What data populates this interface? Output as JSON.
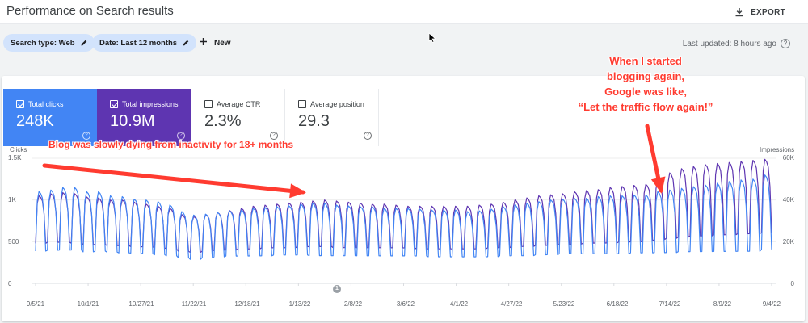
{
  "header": {
    "title": "Performance on Search results",
    "export_label": "EXPORT"
  },
  "filters": {
    "search_type": "Search type: Web",
    "date": "Date: Last 12 months",
    "new_label": "New",
    "last_updated": "Last updated: 8 hours ago"
  },
  "metrics": {
    "clicks": {
      "label": "Total clicks",
      "value": "248K",
      "selected": true
    },
    "impressions": {
      "label": "Total impressions",
      "value": "10.9M",
      "selected": true
    },
    "ctr": {
      "label": "Average CTR",
      "value": "2.3%",
      "selected": false
    },
    "position": {
      "label": "Average position",
      "value": "29.3",
      "selected": false
    }
  },
  "colors": {
    "clicks": "#4285f4",
    "impressions": "#5e35b1",
    "annotation": "#ff3b30"
  },
  "chart_data": {
    "type": "line",
    "left_axis": {
      "label": "Clicks",
      "ticks": [
        "1.5K",
        "1K",
        "500",
        "0"
      ],
      "range": [
        0,
        1500
      ]
    },
    "right_axis": {
      "label": "Impressions",
      "ticks": [
        "60K",
        "40K",
        "20K",
        "0"
      ],
      "range": [
        0,
        60000
      ]
    },
    "x_ticks": [
      "9/5/21",
      "10/1/21",
      "10/27/21",
      "11/22/21",
      "12/18/21",
      "1/13/22",
      "2/8/22",
      "3/6/22",
      "4/1/22",
      "4/27/22",
      "5/23/22",
      "6/18/22",
      "7/14/22",
      "8/9/22",
      "9/4/22"
    ],
    "grid": true,
    "marker_label": "1",
    "series": [
      {
        "name": "Total clicks",
        "axis": "left",
        "weekly_peak": [
          1100,
          1120,
          1150,
          1150,
          1100,
          1100,
          1050,
          1040,
          1010,
          1000,
          980,
          940,
          860,
          820,
          830,
          850,
          870,
          880,
          900,
          910,
          920,
          930,
          950,
          960,
          960,
          940,
          930,
          920,
          920,
          900,
          900,
          900,
          890,
          880,
          880,
          880,
          860,
          870,
          890,
          920,
          940,
          960,
          980,
          1000,
          1010,
          1020,
          1020,
          1040,
          1050,
          1050,
          1060,
          1060,
          1100,
          1120,
          1140,
          1160,
          1180,
          1200,
          1220,
          1240,
          1250,
          1300
        ],
        "weekly_trough": [
          350,
          360,
          360,
          360,
          340,
          350,
          340,
          330,
          330,
          320,
          310,
          300,
          280,
          260,
          280,
          290,
          300,
          300,
          300,
          300,
          310,
          310,
          310,
          300,
          300,
          300,
          300,
          300,
          300,
          300,
          300,
          300,
          300,
          290,
          290,
          290,
          290,
          290,
          290,
          300,
          300,
          300,
          310,
          310,
          320,
          320,
          320,
          320,
          320,
          320,
          330,
          330,
          330,
          330,
          340,
          340,
          340,
          340,
          340,
          340,
          340,
          360
        ]
      },
      {
        "name": "Total impressions",
        "axis": "right",
        "weekly_peak": [
          42000,
          43000,
          43500,
          43000,
          41500,
          41000,
          40000,
          40000,
          39000,
          38000,
          37000,
          36000,
          33000,
          32000,
          33000,
          34000,
          35000,
          36000,
          37000,
          37500,
          38000,
          38500,
          39000,
          39500,
          40000,
          39500,
          39000,
          38500,
          38000,
          38000,
          37500,
          37000,
          37000,
          37000,
          37000,
          37000,
          37000,
          37500,
          38000,
          39000,
          40000,
          41000,
          42000,
          42500,
          43000,
          44000,
          44500,
          45000,
          46000,
          46500,
          47000,
          47500,
          50000,
          53000,
          55000,
          56000,
          57000,
          57500,
          58000,
          58500,
          59000,
          59500
        ],
        "weekly_trough": [
          18000,
          18500,
          18500,
          18000,
          17500,
          17500,
          17000,
          17000,
          16500,
          16500,
          16000,
          15500,
          14500,
          14000,
          14500,
          15000,
          15000,
          15500,
          15500,
          16000,
          16000,
          16000,
          16500,
          16500,
          16500,
          16000,
          16000,
          16000,
          16000,
          16000,
          16000,
          16000,
          15500,
          15500,
          15500,
          15500,
          15500,
          15500,
          16000,
          16000,
          16500,
          16500,
          17000,
          17000,
          17500,
          17500,
          18000,
          18000,
          18000,
          18500,
          18500,
          19000,
          19500,
          20000,
          20500,
          21000,
          21000,
          21500,
          21500,
          22000,
          22000,
          22500
        ]
      }
    ]
  },
  "annotations": {
    "left": "Blog was slowly dying from inactivity for 18+ months",
    "right_lines": [
      "When I started",
      "blogging again,",
      "Google was like,",
      "“Let the traffic flow again!”"
    ]
  }
}
